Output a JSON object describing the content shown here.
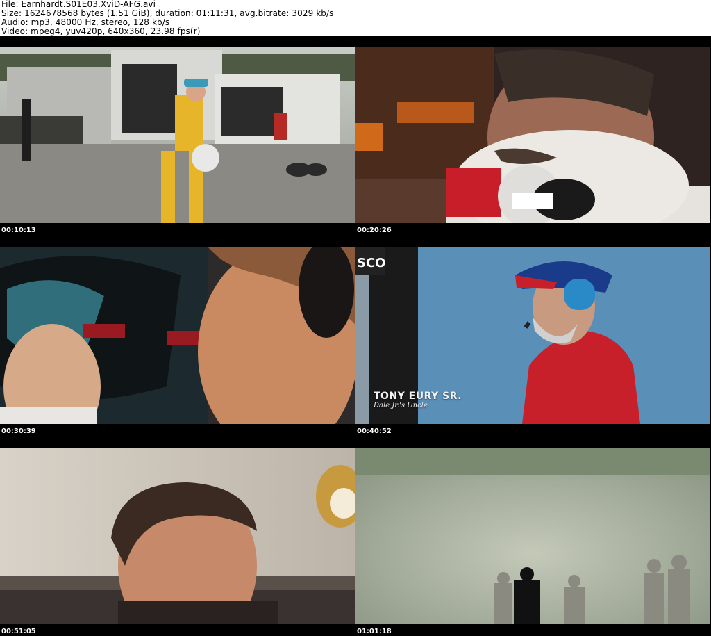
{
  "header": {
    "file_line": "File: Earnhardt.S01E03.XviD-AFG.avi",
    "size_line": "Size: 1624678568 bytes (1.51 GiB), duration: 01:11:31, avg.bitrate: 3029 kb/s",
    "audio_line": "Audio: mp3, 48000 Hz, stereo, 128 kb/s",
    "video_line": "Video: mpeg4, yuv420p, 640x360, 23.98 fps(r)"
  },
  "frames": [
    {
      "timestamp": "00:10:13",
      "scene": "pit-area-driver-walking"
    },
    {
      "timestamp": "00:20:26",
      "scene": "driver-in-car-with-microphone"
    },
    {
      "timestamp": "00:30:39",
      "scene": "driver-putting-on-helmet"
    },
    {
      "timestamp": "00:40:52",
      "scene": "man-with-headset",
      "caption_name": "TONY EURY SR.",
      "caption_role": "Dale Jr.'s Uncle",
      "sign_text": "SCO"
    },
    {
      "timestamp": "00:51:05",
      "scene": "man-profile-indoors"
    },
    {
      "timestamp": "01:01:18",
      "scene": "silhouettes-in-smoke"
    }
  ],
  "colors": {
    "background": "#000000",
    "header_bg": "#ffffff",
    "header_text": "#000000",
    "timestamp_text": "#ffffff"
  }
}
